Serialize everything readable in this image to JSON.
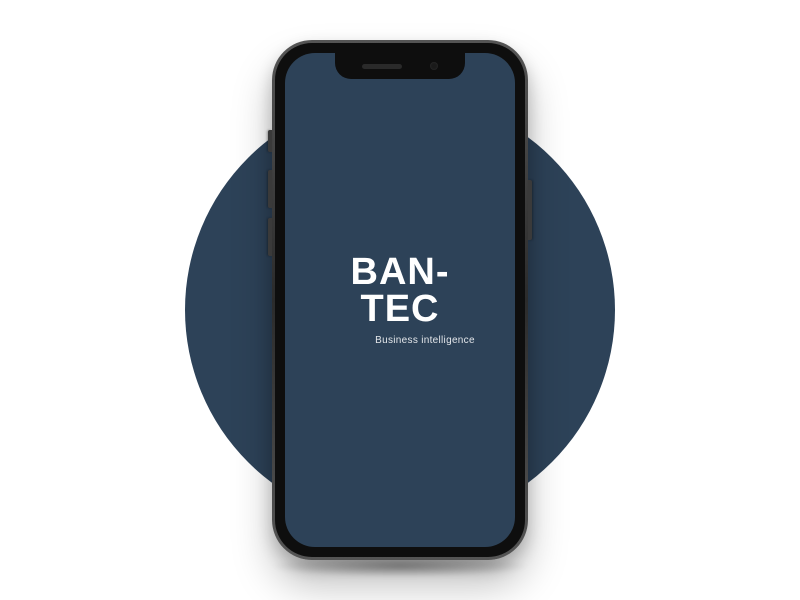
{
  "colors": {
    "brand_bg": "#2d4258",
    "brand_text": "#ffffff",
    "tagline_text": "#e3e6ea",
    "phone_body": "#0e0e0e"
  },
  "splash": {
    "brand_line1": "BAN-",
    "brand_line2": "TEC",
    "tagline": "Business intelligence"
  }
}
